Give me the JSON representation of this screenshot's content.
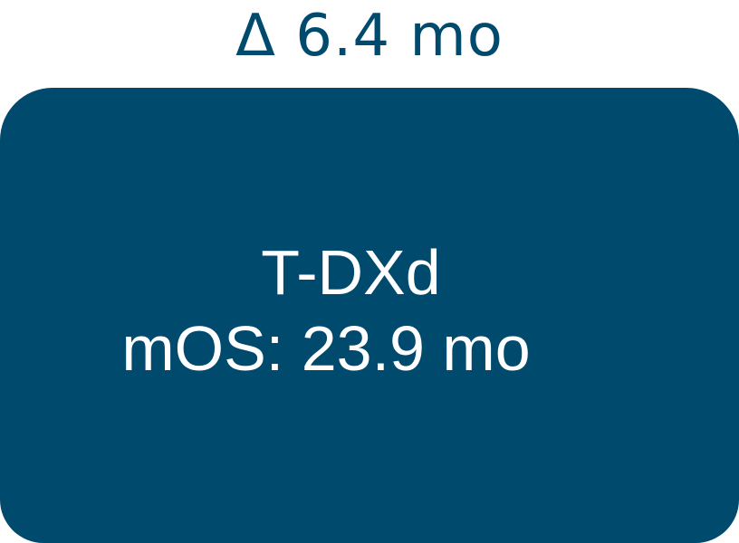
{
  "header": {
    "delta_label": "Δ 6.4 mo"
  },
  "box": {
    "drug": "T-DXd",
    "mos_label": "mOS: 23.9 mo"
  },
  "colors": {
    "box_fill": "#004a6e",
    "header_text": "#004a6e",
    "box_text": "#ffffff"
  }
}
